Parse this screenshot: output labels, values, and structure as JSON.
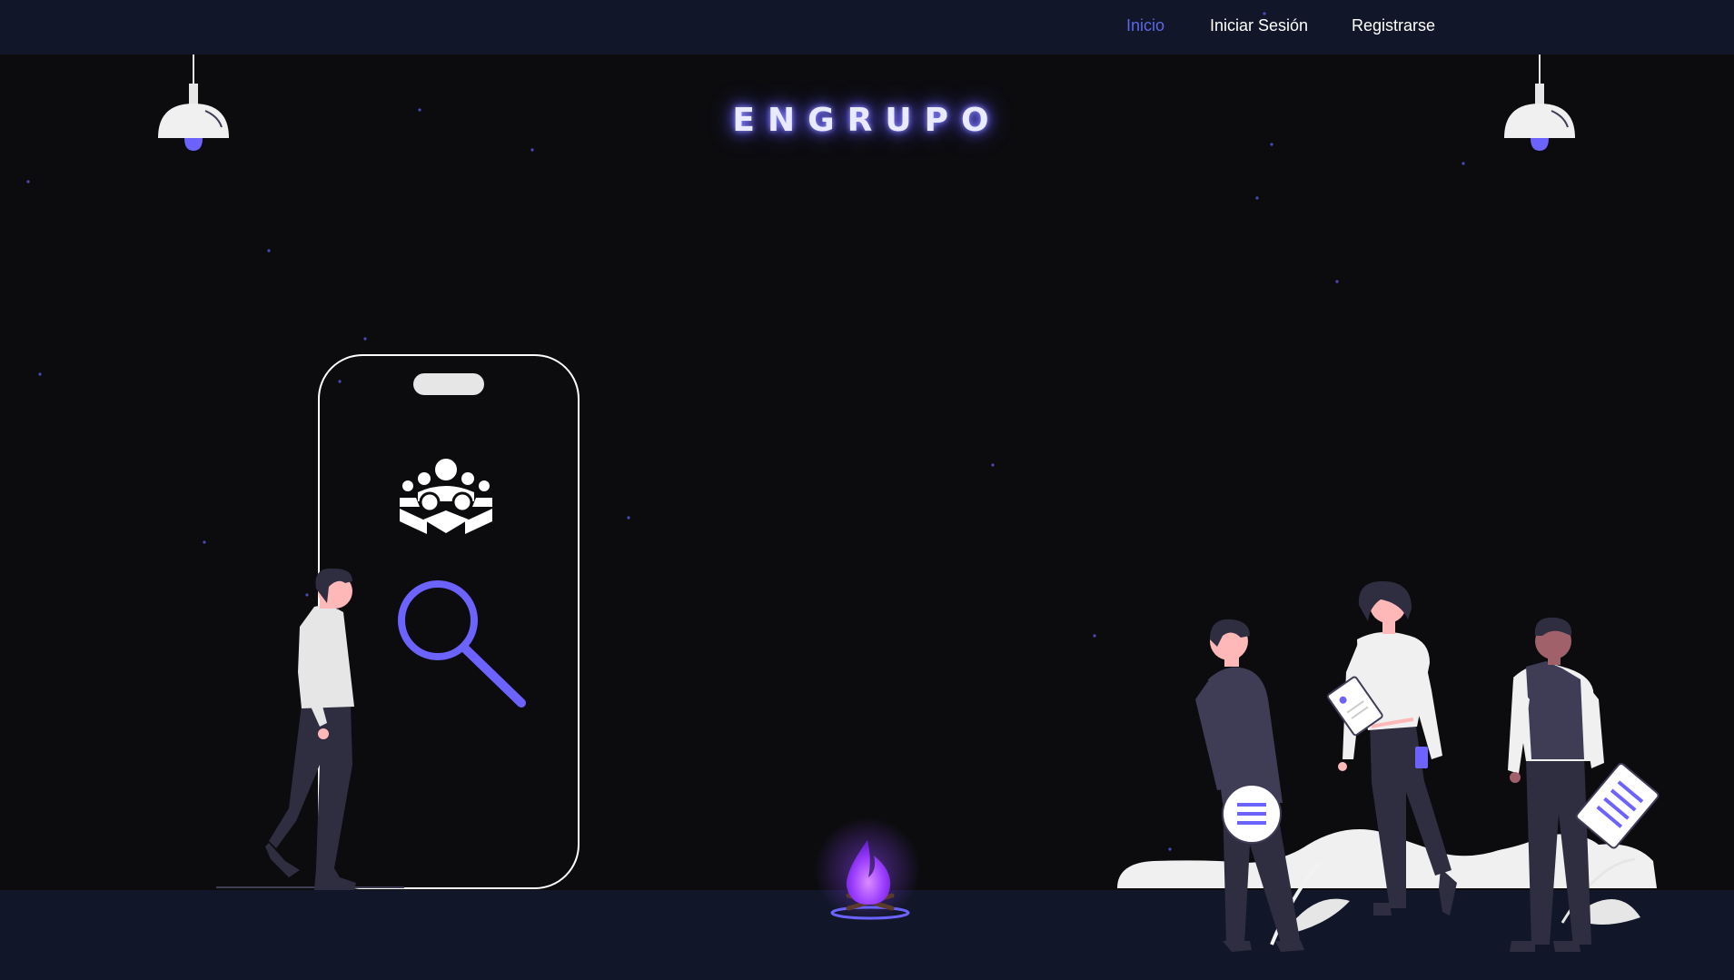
{
  "nav": {
    "links": [
      {
        "label": "Inicio",
        "active": true
      },
      {
        "label": "Iniciar Sesión",
        "active": false
      },
      {
        "label": "Registrarse",
        "active": false
      }
    ]
  },
  "brand": {
    "title": "ENGRUPO"
  },
  "colors": {
    "navbar_bg": "#111628",
    "page_bg": "#0c0c0f",
    "accent": "#6c63ff",
    "active_link": "#5b67e6"
  },
  "icons": [
    "ceiling-lamp-icon",
    "group-icon",
    "search-icon",
    "campfire-icon",
    "document-icon"
  ]
}
